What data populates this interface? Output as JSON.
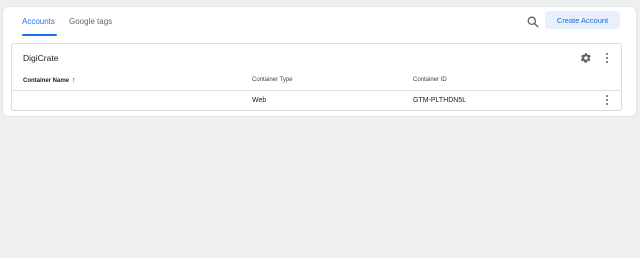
{
  "tabs": [
    {
      "label": "Accounts",
      "active": true
    },
    {
      "label": "Google tags",
      "active": false
    }
  ],
  "header": {
    "search_icon": "search-icon",
    "create_account_label": "Create Account"
  },
  "account": {
    "name": "DigiCrate",
    "settings_icon": "gear-icon",
    "more_icon": "more-vert-icon"
  },
  "table": {
    "columns": [
      {
        "label": "Container Name",
        "sorted": "ascending"
      },
      {
        "label": "Container Type"
      },
      {
        "label": "Container ID"
      }
    ],
    "rows": [
      {
        "name": "",
        "type": "Web",
        "id": "GTM-PLTHDN5L"
      }
    ]
  },
  "colors": {
    "accent": "#1a73e8",
    "button_bg": "#e8f0fe",
    "page_bg": "#eeeff1"
  }
}
